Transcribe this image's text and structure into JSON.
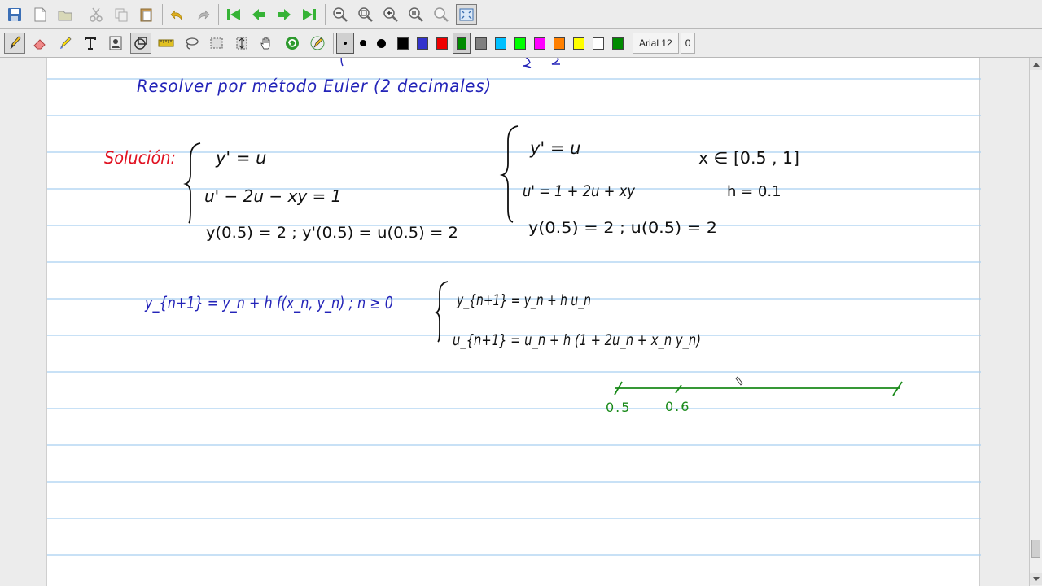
{
  "toolbar_top": {
    "buttons": [
      {
        "name": "save-icon"
      },
      {
        "name": "new-page-icon"
      },
      {
        "name": "open-folder-icon"
      },
      {
        "name": "cut-icon"
      },
      {
        "name": "copy-icon"
      },
      {
        "name": "paste-icon"
      },
      {
        "name": "undo-icon"
      },
      {
        "name": "redo-icon"
      },
      {
        "name": "first-page-icon"
      },
      {
        "name": "previous-page-icon"
      },
      {
        "name": "next-page-icon"
      },
      {
        "name": "last-page-icon"
      },
      {
        "name": "zoom-out-icon"
      },
      {
        "name": "zoom-fit-icon"
      },
      {
        "name": "zoom-in-icon"
      },
      {
        "name": "zoom-100-icon"
      },
      {
        "name": "zoom-custom-icon"
      },
      {
        "name": "fullscreen-icon"
      }
    ]
  },
  "toolbar_tools": {
    "tools": [
      {
        "name": "pen-icon",
        "active": true
      },
      {
        "name": "eraser-icon"
      },
      {
        "name": "highlighter-icon"
      },
      {
        "name": "text-tool-icon"
      },
      {
        "name": "image-tool-icon"
      },
      {
        "name": "shape-recognizer-icon",
        "active": true
      },
      {
        "name": "ruler-icon"
      },
      {
        "name": "lasso-select-icon"
      },
      {
        "name": "rectangle-select-icon"
      },
      {
        "name": "vertical-space-icon"
      },
      {
        "name": "hand-tool-icon"
      },
      {
        "name": "default-pen-icon"
      },
      {
        "name": "pen-settings-icon"
      }
    ],
    "thickness": [
      {
        "size": "fine",
        "active": true
      },
      {
        "size": "medium"
      },
      {
        "size": "thick"
      }
    ],
    "colors": [
      {
        "name": "black",
        "hex": "#000000"
      },
      {
        "name": "blue",
        "hex": "#3333cc"
      },
      {
        "name": "red",
        "hex": "#ee0000"
      },
      {
        "name": "green",
        "hex": "#008a00",
        "active": true
      },
      {
        "name": "gray",
        "hex": "#808080"
      },
      {
        "name": "light-blue",
        "hex": "#00c0ff"
      },
      {
        "name": "light-green",
        "hex": "#00ff00"
      },
      {
        "name": "magenta",
        "hex": "#ff00ff"
      },
      {
        "name": "orange",
        "hex": "#ff8000"
      },
      {
        "name": "yellow",
        "hex": "#ffff00"
      },
      {
        "name": "white",
        "hex": "#ffffff"
      },
      {
        "name": "custom-green",
        "hex": "#008a00"
      }
    ],
    "font": "Arial 12",
    "font_extra": "0"
  },
  "page": {
    "ruling_color": "#a8cff0",
    "line_ys": [
      26,
      71,
      116,
      161,
      206,
      251,
      296,
      341,
      386,
      431,
      476,
      521,
      566,
      611
    ],
    "ink": {
      "blue": "#2424b8",
      "black": "#101010",
      "red": "#e01020",
      "green": "#1a8a1a"
    },
    "text": {
      "instruction": "Resolver por método Euler (2 decimales)",
      "solution_label": "Solución:",
      "sys1_eq1": "y' = u",
      "sys1_eq2": "u' − 2u − xy = 1",
      "sys1_ic": "y(0.5) = 2 ;  y'(0.5) = u(0.5) = 2",
      "sys2_eq1": "y' = u",
      "sys2_eq2": "u' = 1 + 2u + xy",
      "sys2_ic": "y(0.5) = 2 ;  u(0.5) = 2",
      "interval": "x ∈ [0.5 , 1]",
      "step": "h = 0.1",
      "euler_main": "y_{n+1} = y_n + h f(x_n, y_n) ; n ≥ 0",
      "euler_y": "y_{n+1} = y_n + h u_n",
      "euler_u": "u_{n+1} = u_n + h (1 + 2u_n + x_n y_n)",
      "axis_label_1": "0.5",
      "axis_label_2": "0.6"
    }
  }
}
